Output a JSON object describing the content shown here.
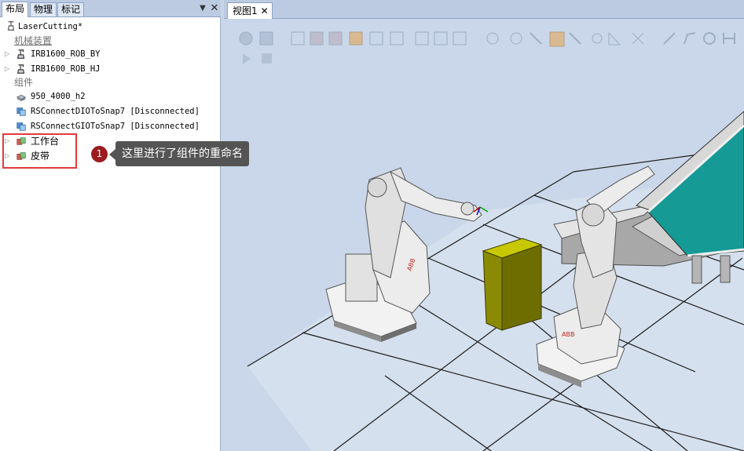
{
  "left_panel": {
    "tabs": [
      "布局",
      "物理",
      "标记"
    ],
    "tree": {
      "station": "LaserCutting*",
      "section_mechanisms": "机械装置",
      "mechanisms": [
        "IRB1600_ROB_BY",
        "IRB1600_ROB_HJ"
      ],
      "section_components": "组件",
      "components": [
        "950_4000_h2",
        "RSConnectDIOToSnap7 [Disconnected]",
        "RSConnectGIOToSnap7 [Disconnected]",
        "工作台",
        "皮带"
      ]
    }
  },
  "viewport": {
    "tab_label": "视图1",
    "close_glyph": "✕"
  },
  "callout": {
    "number": "1",
    "text": "这里进行了组件的重命名"
  },
  "colors": {
    "highlight": "#e4393c",
    "callout_badge": "#9b1b1f",
    "callout_bubble": "#545454",
    "conveyor_belt": "#159a96",
    "box": "#8a8a05"
  },
  "icons": [
    "robot-icon",
    "component-icon",
    "station-icon",
    "expand-arrow-icon"
  ]
}
